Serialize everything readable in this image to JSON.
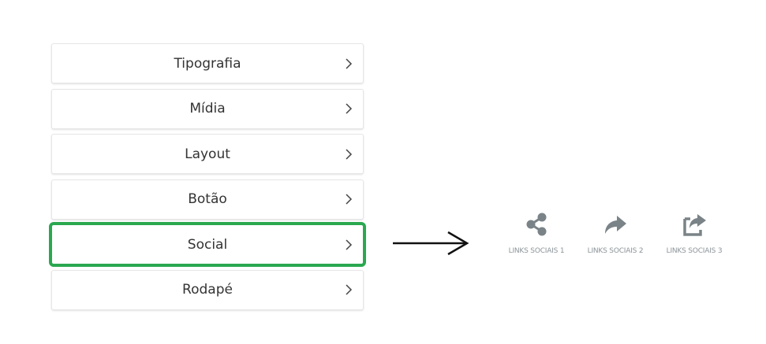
{
  "menu": {
    "items": [
      {
        "label": "Tipografia"
      },
      {
        "label": "Mídia"
      },
      {
        "label": "Layout"
      },
      {
        "label": "Botão"
      },
      {
        "label": "Social"
      },
      {
        "label": "Rodapé"
      }
    ],
    "highlighted_item": "Social"
  },
  "social_options": [
    {
      "label": "LINKS SOCIAIS 1",
      "icon": "share-nodes-icon"
    },
    {
      "label": "LINKS SOCIAIS 2",
      "icon": "share-arrow-icon"
    },
    {
      "label": "LINKS SOCIAIS 3",
      "icon": "share-square-icon"
    }
  ],
  "colors": {
    "highlight": "#2aa84f",
    "icon": "#7a8387",
    "caption": "#8c9499"
  }
}
